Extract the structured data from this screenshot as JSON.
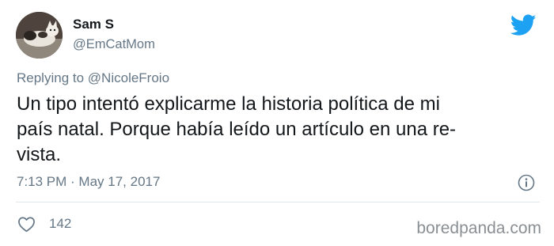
{
  "author": {
    "display_name": "Sam S",
    "handle": "@EmCatMom",
    "avatar_icon": "cat-avatar"
  },
  "platform_icon": "twitter-bird-icon",
  "brand_color": "#1DA1F2",
  "reply": {
    "prefix": "Replying to",
    "mention": "@NicoleFroio"
  },
  "tweet": {
    "text": "Un tipo intentó explicarme la historia política de mi\npaís natal. Porque había leído un artículo en una re-\nvista.",
    "timestamp": "7:13 PM · May 17, 2017"
  },
  "actions": {
    "like_icon": "heart-icon",
    "like_count": "142",
    "info_icon": "info-icon"
  },
  "watermark": "boredpanda.com"
}
